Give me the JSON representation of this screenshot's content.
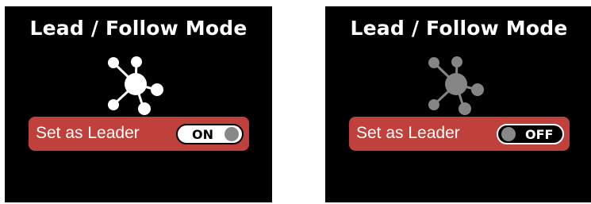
{
  "colors": {
    "background": "#000000",
    "row_background": "#c0403b",
    "row_text": "#ffffff",
    "icon_active": "#ffffff",
    "icon_inactive": "#858585",
    "toggle_on_knob": "#888888",
    "toggle_off_knob": "#888888",
    "toggle_on_track": "#ffffff",
    "toggle_off_track": "#000000"
  },
  "screens": [
    {
      "title": "Lead / Follow Mode",
      "icon": "network-hub-icon",
      "icon_state": "active",
      "setting": {
        "label": "Set as Leader",
        "toggle_text": "ON",
        "toggle_on": true
      }
    },
    {
      "title": "Lead / Follow Mode",
      "icon": "network-hub-icon",
      "icon_state": "inactive",
      "setting": {
        "label": "Set as Leader",
        "toggle_text": "OFF",
        "toggle_on": false
      }
    }
  ]
}
